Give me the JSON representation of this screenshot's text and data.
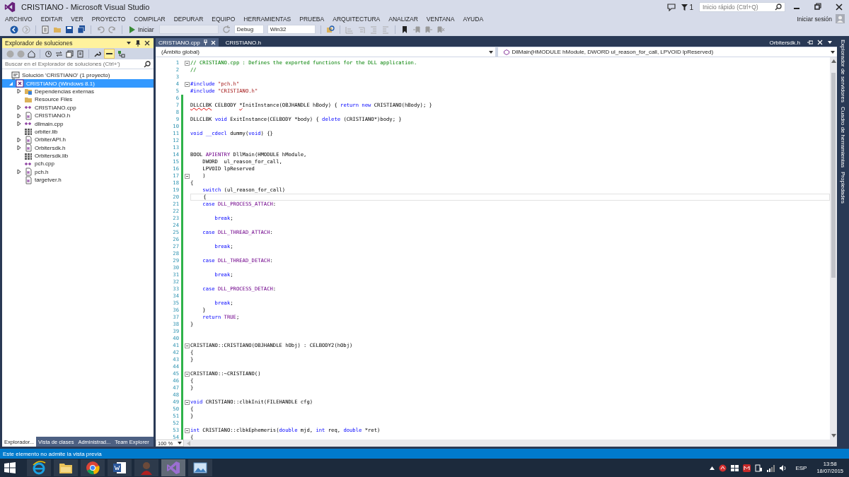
{
  "window": {
    "title": "CRISTIANO - Microsoft Visual Studio"
  },
  "title_bar": {
    "notifications": "1",
    "quick_launch": {
      "placeholder": "Inicio rápido (Ctrl+Q)"
    },
    "sign_in": "Iniciar sesión"
  },
  "menu": [
    "ARCHIVO",
    "EDITAR",
    "VER",
    "PROYECTO",
    "COMPILAR",
    "DEPURAR",
    "EQUIPO",
    "HERRAMIENTAS",
    "PRUEBA",
    "ARQUITECTURA",
    "ANALIZAR",
    "VENTANA",
    "AYUDA"
  ],
  "toolbar": {
    "start": "Iniciar",
    "configuration": "Debug",
    "platform": "Win32"
  },
  "solution_explorer": {
    "title": "Explorador de soluciones",
    "search": {
      "placeholder": "Buscar en el Explorador de soluciones (Ctrl+')"
    },
    "tree": [
      {
        "label": "Solución 'CRISTIANO'  (1 proyecto)",
        "kind": "solution",
        "expandable": false,
        "expanded": true,
        "selected": false,
        "children": [
          {
            "label": "CRISTIANO (Windows 8.1)",
            "kind": "project",
            "expandable": true,
            "expanded": true,
            "selected": true,
            "children": [
              {
                "label": "Dependencias externas",
                "kind": "deps",
                "expandable": true,
                "expanded": false,
                "selected": false
              },
              {
                "label": "Resource Files",
                "kind": "folder",
                "expandable": false,
                "expanded": false,
                "selected": false
              },
              {
                "label": "CRISTIANO.cpp",
                "kind": "cpp",
                "expandable": true,
                "expanded": false,
                "selected": false
              },
              {
                "label": "CRISTIANO.h",
                "kind": "h",
                "expandable": true,
                "expanded": false,
                "selected": false
              },
              {
                "label": "dllmain.cpp",
                "kind": "cpp",
                "expandable": true,
                "expanded": false,
                "selected": false
              },
              {
                "label": "orbiter.lib",
                "kind": "lib",
                "expandable": false,
                "expanded": false,
                "selected": false
              },
              {
                "label": "OrbiterAPI.h",
                "kind": "h",
                "expandable": true,
                "expanded": false,
                "selected": false
              },
              {
                "label": "Orbitersdk.h",
                "kind": "h",
                "expandable": true,
                "expanded": false,
                "selected": false
              },
              {
                "label": "Orbitersdk.lib",
                "kind": "lib",
                "expandable": false,
                "expanded": false,
                "selected": false
              },
              {
                "label": "pch.cpp",
                "kind": "cpp",
                "expandable": false,
                "expanded": false,
                "selected": false
              },
              {
                "label": "pch.h",
                "kind": "h",
                "expandable": true,
                "expanded": false,
                "selected": false
              },
              {
                "label": "targetver.h",
                "kind": "h",
                "expandable": false,
                "expanded": false,
                "selected": false
              }
            ]
          }
        ]
      }
    ],
    "bottom_tabs": [
      {
        "label": "Explorador...",
        "selected": true
      },
      {
        "label": "Vista de clases",
        "selected": false
      },
      {
        "label": "Administrad...",
        "selected": false
      },
      {
        "label": "Team Explorer",
        "selected": false
      }
    ]
  },
  "editor": {
    "tabs": [
      {
        "label": "CRISTIANO.cpp",
        "selected": true
      },
      {
        "label": "CRISTIANO.h",
        "selected": false
      }
    ],
    "preview_tab": "Orbitersdk.h",
    "scope": "(Ámbito global)",
    "member": "DllMain(HMODULE hModule, DWORD ul_reason_for_call, LPVOID lpReserved)",
    "zoom": "100 %",
    "lines": [
      {
        "n": "1",
        "fold": true,
        "changed": false,
        "current": false,
        "tokens": [
          {
            "kind": "comment",
            "text": "// CRISTIANO.cpp : Defines the exported functions for the DLL application."
          }
        ]
      },
      {
        "n": "2",
        "fold": false,
        "changed": false,
        "current": false,
        "tokens": [
          {
            "kind": "comment",
            "text": "//"
          }
        ]
      },
      {
        "n": "3",
        "fold": false,
        "changed": false,
        "current": false
      },
      {
        "n": "4",
        "fold": true,
        "changed": false,
        "current": false,
        "tokens": [
          {
            "kind": "keyword",
            "text": "#include "
          },
          {
            "kind": "string",
            "text": "\"pch.h\""
          }
        ]
      },
      {
        "n": "5",
        "fold": false,
        "changed": false,
        "current": false,
        "tokens": [
          {
            "kind": "keyword",
            "text": "#include "
          },
          {
            "kind": "string",
            "text": "\"CRISTIANO.h\""
          }
        ]
      },
      {
        "n": "6",
        "fold": false,
        "changed": true,
        "current": false
      },
      {
        "n": "7",
        "fold": false,
        "changed": true,
        "current": false,
        "tokens": [
          {
            "kind": "error",
            "text": "DLLCLBK"
          },
          {
            "kind": "plain",
            "text": " CELBODY "
          },
          {
            "kind": "error",
            "text": "*"
          },
          {
            "kind": "plain",
            "text": "InitInstance(OBJHANDLE hBody) { "
          },
          {
            "kind": "keyword",
            "text": "return new"
          },
          {
            "kind": "plain",
            "text": " CRISTIANO(hBody); }"
          }
        ]
      },
      {
        "n": "8",
        "fold": false,
        "changed": true,
        "current": false
      },
      {
        "n": "9",
        "fold": false,
        "changed": true,
        "current": false,
        "tokens": [
          {
            "kind": "plain",
            "text": "DLLCLBK "
          },
          {
            "kind": "keyword",
            "text": "void"
          },
          {
            "kind": "plain",
            "text": " ExitInstance(CELBODY *body) { "
          },
          {
            "kind": "keyword",
            "text": "delete"
          },
          {
            "kind": "plain",
            "text": " (CRISTIANO*)body; }"
          }
        ]
      },
      {
        "n": "10",
        "fold": false,
        "changed": true,
        "current": false
      },
      {
        "n": "11",
        "fold": false,
        "changed": true,
        "current": false,
        "tokens": [
          {
            "kind": "keyword",
            "text": "void __cdecl"
          },
          {
            "kind": "plain",
            "text": " dummy("
          },
          {
            "kind": "keyword",
            "text": "void"
          },
          {
            "kind": "plain",
            "text": ") {}"
          }
        ]
      },
      {
        "n": "12",
        "fold": false,
        "changed": true,
        "current": false
      },
      {
        "n": "13",
        "fold": false,
        "changed": true,
        "current": false
      },
      {
        "n": "14",
        "fold": false,
        "changed": true,
        "current": false,
        "tokens": [
          {
            "kind": "plain",
            "text": "BOOL "
          },
          {
            "kind": "macro",
            "text": "APIENTRY"
          },
          {
            "kind": "plain",
            "text": " DllMain(HMODULE hModule,"
          }
        ]
      },
      {
        "n": "15",
        "fold": false,
        "changed": true,
        "current": false,
        "tokens": [
          {
            "kind": "plain",
            "text": "    DWORD  ul_reason_for_call,"
          }
        ]
      },
      {
        "n": "16",
        "fold": false,
        "changed": true,
        "current": false,
        "tokens": [
          {
            "kind": "plain",
            "text": "    LPVOID lpReserved"
          }
        ]
      },
      {
        "n": "17",
        "fold": true,
        "changed": true,
        "current": false,
        "tokens": [
          {
            "kind": "plain",
            "text": "    )"
          }
        ]
      },
      {
        "n": "18",
        "fold": false,
        "changed": true,
        "current": false,
        "tokens": [
          {
            "kind": "plain",
            "text": "{"
          }
        ]
      },
      {
        "n": "19",
        "fold": false,
        "changed": true,
        "current": false,
        "tokens": [
          {
            "kind": "keyword",
            "text": "    switch"
          },
          {
            "kind": "plain",
            "text": " (ul_reason_for_call)"
          }
        ]
      },
      {
        "n": "20",
        "fold": false,
        "changed": true,
        "current": true,
        "tokens": [
          {
            "kind": "plain",
            "text": "    {"
          }
        ]
      },
      {
        "n": "21",
        "fold": false,
        "changed": true,
        "current": false,
        "tokens": [
          {
            "kind": "keyword",
            "text": "    case "
          },
          {
            "kind": "macro",
            "text": "DLL_PROCESS_ATTACH"
          },
          {
            "kind": "plain",
            "text": ":"
          }
        ]
      },
      {
        "n": "22",
        "fold": false,
        "changed": true,
        "current": false
      },
      {
        "n": "23",
        "fold": false,
        "changed": true,
        "current": false,
        "tokens": [
          {
            "kind": "keyword",
            "text": "        break"
          },
          {
            "kind": "plain",
            "text": ";"
          }
        ]
      },
      {
        "n": "24",
        "fold": false,
        "changed": true,
        "current": false
      },
      {
        "n": "25",
        "fold": false,
        "changed": true,
        "current": false,
        "tokens": [
          {
            "kind": "keyword",
            "text": "    case "
          },
          {
            "kind": "macro",
            "text": "DLL_THREAD_ATTACH"
          },
          {
            "kind": "plain",
            "text": ":"
          }
        ]
      },
      {
        "n": "26",
        "fold": false,
        "changed": true,
        "current": false
      },
      {
        "n": "27",
        "fold": false,
        "changed": true,
        "current": false,
        "tokens": [
          {
            "kind": "keyword",
            "text": "        break"
          },
          {
            "kind": "plain",
            "text": ";"
          }
        ]
      },
      {
        "n": "28",
        "fold": false,
        "changed": true,
        "current": false
      },
      {
        "n": "29",
        "fold": false,
        "changed": true,
        "current": false,
        "tokens": [
          {
            "kind": "keyword",
            "text": "    case "
          },
          {
            "kind": "macro",
            "text": "DLL_THREAD_DETACH"
          },
          {
            "kind": "plain",
            "text": ":"
          }
        ]
      },
      {
        "n": "30",
        "fold": false,
        "changed": true,
        "current": false
      },
      {
        "n": "31",
        "fold": false,
        "changed": true,
        "current": false,
        "tokens": [
          {
            "kind": "keyword",
            "text": "        break"
          },
          {
            "kind": "plain",
            "text": ";"
          }
        ]
      },
      {
        "n": "32",
        "fold": false,
        "changed": true,
        "current": false
      },
      {
        "n": "33",
        "fold": false,
        "changed": true,
        "current": false,
        "tokens": [
          {
            "kind": "keyword",
            "text": "    case "
          },
          {
            "kind": "macro",
            "text": "DLL_PROCESS_DETACH"
          },
          {
            "kind": "plain",
            "text": ":"
          }
        ]
      },
      {
        "n": "34",
        "fold": false,
        "changed": true,
        "current": false
      },
      {
        "n": "35",
        "fold": false,
        "changed": true,
        "current": false,
        "tokens": [
          {
            "kind": "keyword",
            "text": "        break"
          },
          {
            "kind": "plain",
            "text": ";"
          }
        ]
      },
      {
        "n": "36",
        "fold": false,
        "changed": true,
        "current": false,
        "tokens": [
          {
            "kind": "plain",
            "text": "    }"
          }
        ]
      },
      {
        "n": "37",
        "fold": false,
        "changed": true,
        "current": false,
        "tokens": [
          {
            "kind": "keyword",
            "text": "    return "
          },
          {
            "kind": "macro",
            "text": "TRUE"
          },
          {
            "kind": "plain",
            "text": ";"
          }
        ]
      },
      {
        "n": "38",
        "fold": false,
        "changed": true,
        "current": false,
        "tokens": [
          {
            "kind": "plain",
            "text": "}"
          }
        ]
      },
      {
        "n": "39",
        "fold": false,
        "changed": true,
        "current": false
      },
      {
        "n": "40",
        "fold": false,
        "changed": true,
        "current": false
      },
      {
        "n": "41",
        "fold": true,
        "changed": true,
        "current": false,
        "tokens": [
          {
            "kind": "plain",
            "text": "CRISTIANO::CRISTIANO(OBJHANDLE hObj) : CELBODY2(hObj)"
          }
        ]
      },
      {
        "n": "42",
        "fold": false,
        "changed": true,
        "current": false,
        "tokens": [
          {
            "kind": "plain",
            "text": "{"
          }
        ]
      },
      {
        "n": "43",
        "fold": false,
        "changed": true,
        "current": false,
        "tokens": [
          {
            "kind": "plain",
            "text": "}"
          }
        ]
      },
      {
        "n": "44",
        "fold": false,
        "changed": true,
        "current": false
      },
      {
        "n": "45",
        "fold": true,
        "changed": true,
        "current": false,
        "tokens": [
          {
            "kind": "plain",
            "text": "CRISTIANO::~CRISTIANO()"
          }
        ]
      },
      {
        "n": "46",
        "fold": false,
        "changed": true,
        "current": false,
        "tokens": [
          {
            "kind": "plain",
            "text": "{"
          }
        ]
      },
      {
        "n": "47",
        "fold": false,
        "changed": true,
        "current": false,
        "tokens": [
          {
            "kind": "plain",
            "text": "}"
          }
        ]
      },
      {
        "n": "48",
        "fold": false,
        "changed": true,
        "current": false
      },
      {
        "n": "49",
        "fold": true,
        "changed": true,
        "current": false,
        "tokens": [
          {
            "kind": "keyword",
            "text": "void"
          },
          {
            "kind": "plain",
            "text": " CRISTIANO::clbkInit(FILEHANDLE cfg)"
          }
        ]
      },
      {
        "n": "50",
        "fold": false,
        "changed": true,
        "current": false,
        "tokens": [
          {
            "kind": "plain",
            "text": "{"
          }
        ]
      },
      {
        "n": "51",
        "fold": false,
        "changed": true,
        "current": false,
        "tokens": [
          {
            "kind": "plain",
            "text": "}"
          }
        ]
      },
      {
        "n": "52",
        "fold": false,
        "changed": true,
        "current": false
      },
      {
        "n": "53",
        "fold": true,
        "changed": true,
        "current": false,
        "tokens": [
          {
            "kind": "keyword",
            "text": "int"
          },
          {
            "kind": "plain",
            "text": " CRISTIANO::clbkEphemeris("
          },
          {
            "kind": "keyword",
            "text": "double"
          },
          {
            "kind": "plain",
            "text": " mjd, "
          },
          {
            "kind": "keyword",
            "text": "int"
          },
          {
            "kind": "plain",
            "text": " req, "
          },
          {
            "kind": "keyword",
            "text": "double"
          },
          {
            "kind": "plain",
            "text": " *ret)"
          }
        ]
      },
      {
        "n": "54",
        "fold": false,
        "changed": true,
        "current": false,
        "tokens": [
          {
            "kind": "plain",
            "text": "{"
          }
        ]
      }
    ]
  },
  "side_tabs": [
    "Explorador de servidores",
    "Cuadro de herramientas",
    "Propiedades"
  ],
  "status_bar": "Este elemento no admite la vista previa",
  "taskbar": {
    "apps": [
      {
        "kind": "ie",
        "selected": false
      },
      {
        "kind": "folder",
        "selected": false
      },
      {
        "kind": "chrome",
        "selected": false
      },
      {
        "kind": "word",
        "selected": false
      },
      {
        "kind": "avatar",
        "selected": false
      },
      {
        "kind": "vs",
        "selected": true
      },
      {
        "kind": "photos",
        "selected": false
      }
    ],
    "language": "ESP",
    "time": "13:58",
    "date": "18/07/2015"
  }
}
